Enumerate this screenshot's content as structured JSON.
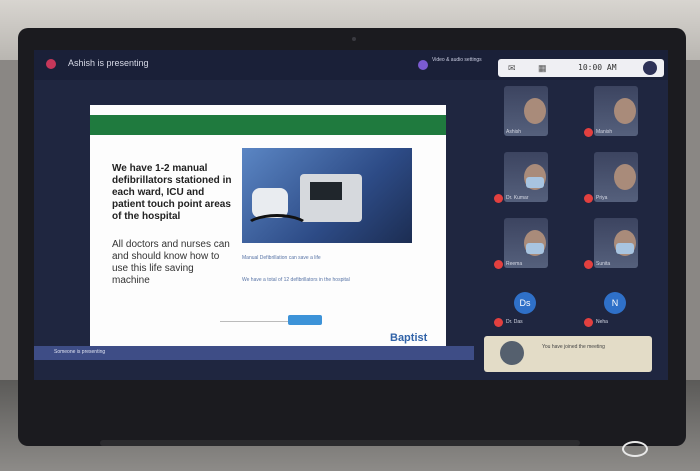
{
  "meeting": {
    "status": "Ashish is presenting",
    "controls_text": "Video & audio settings",
    "time": "10:00 AM"
  },
  "slide": {
    "title": "We have 1-2 manual defibrillators stationed in each ward, ICU and patient touch point areas of the hospital",
    "body": "All doctors and nurses can and should know how to use this life saving machine",
    "caption": "Manual Defibrillation can save a life",
    "caption2": "We have a total of 12 defibrillators in the hospital",
    "brand": "Baptist"
  },
  "participants": [
    {
      "name": "Ashish",
      "type": "video"
    },
    {
      "name": "Manish",
      "type": "video"
    },
    {
      "name": "Dr. Kumar",
      "type": "video"
    },
    {
      "name": "Priya",
      "type": "video"
    },
    {
      "name": "Reema",
      "type": "video"
    },
    {
      "name": "Sunita",
      "type": "video"
    },
    {
      "name": "Dr. Das",
      "type": "initial",
      "initial": "Ds"
    },
    {
      "name": "Neha",
      "type": "initial",
      "initial": "N"
    }
  ],
  "banner": "Someone is presenting",
  "notification": "You have joined the meeting",
  "colors": {
    "accent": "#1f7a3e",
    "screen_bg": "#1f2640"
  }
}
